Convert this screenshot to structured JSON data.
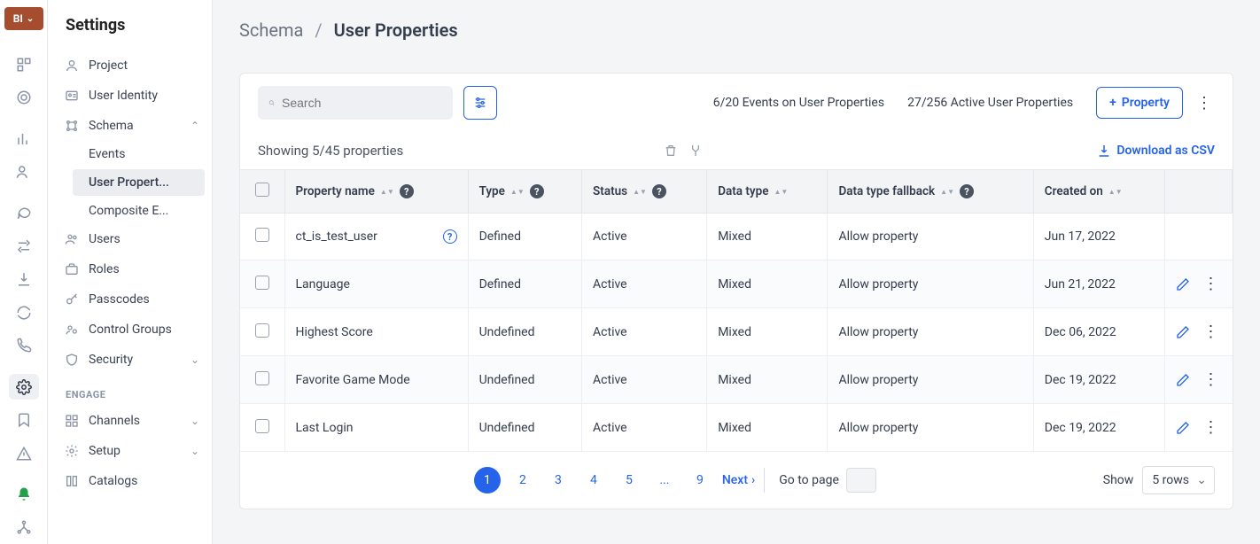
{
  "brand": {
    "label": "BI"
  },
  "sidebar": {
    "title": "Settings",
    "items": [
      {
        "label": "Project"
      },
      {
        "label": "User Identity"
      },
      {
        "label": "Schema"
      },
      {
        "label": "Users"
      },
      {
        "label": "Roles"
      },
      {
        "label": "Passcodes"
      },
      {
        "label": "Control Groups"
      },
      {
        "label": "Security"
      }
    ],
    "schema_sub": [
      {
        "label": "Events"
      },
      {
        "label": "User Propert..."
      },
      {
        "label": "Composite E..."
      }
    ],
    "engage_heading": "ENGAGE",
    "engage": [
      {
        "label": "Channels"
      },
      {
        "label": "Setup"
      },
      {
        "label": "Catalogs"
      }
    ]
  },
  "breadcrumb": {
    "parent": "Schema",
    "sep": "/",
    "current": "User Properties"
  },
  "toolbar": {
    "search_placeholder": "Search",
    "events_text": "6/20 Events on User Properties",
    "active_text": "27/256 Active User Properties",
    "add_label": "Property"
  },
  "strip": {
    "count_text": "Showing 5/45 properties",
    "download_label": "Download as CSV"
  },
  "columns": {
    "c1": "Property name",
    "c2": "Type",
    "c3": "Status",
    "c4": "Data type",
    "c5": "Data type fallback",
    "c6": "Created on"
  },
  "rows": [
    {
      "name": "ct_is_test_user",
      "type": "Defined",
      "status": "Active",
      "dtype": "Mixed",
      "fallback": "Allow property",
      "created": "Jun 17, 2022",
      "info": true,
      "actions": false
    },
    {
      "name": "Language",
      "type": "Defined",
      "status": "Active",
      "dtype": "Mixed",
      "fallback": "Allow property",
      "created": "Jun 21, 2022",
      "info": false,
      "actions": true
    },
    {
      "name": "Highest Score",
      "type": "Undefined",
      "status": "Active",
      "dtype": "Mixed",
      "fallback": "Allow property",
      "created": "Dec 06, 2022",
      "info": false,
      "actions": true
    },
    {
      "name": "Favorite Game Mode",
      "type": "Undefined",
      "status": "Active",
      "dtype": "Mixed",
      "fallback": "Allow property",
      "created": "Dec 19, 2022",
      "info": false,
      "actions": true
    },
    {
      "name": "Last Login",
      "type": "Undefined",
      "status": "Active",
      "dtype": "Mixed",
      "fallback": "Allow property",
      "created": "Dec 19, 2022",
      "info": false,
      "actions": true
    }
  ],
  "pager": {
    "pages": [
      "1",
      "2",
      "3",
      "4",
      "5",
      "...",
      "9"
    ],
    "active": "1",
    "next": "Next",
    "goto_label": "Go to page",
    "show_label": "Show",
    "rows_label": "5 rows"
  }
}
